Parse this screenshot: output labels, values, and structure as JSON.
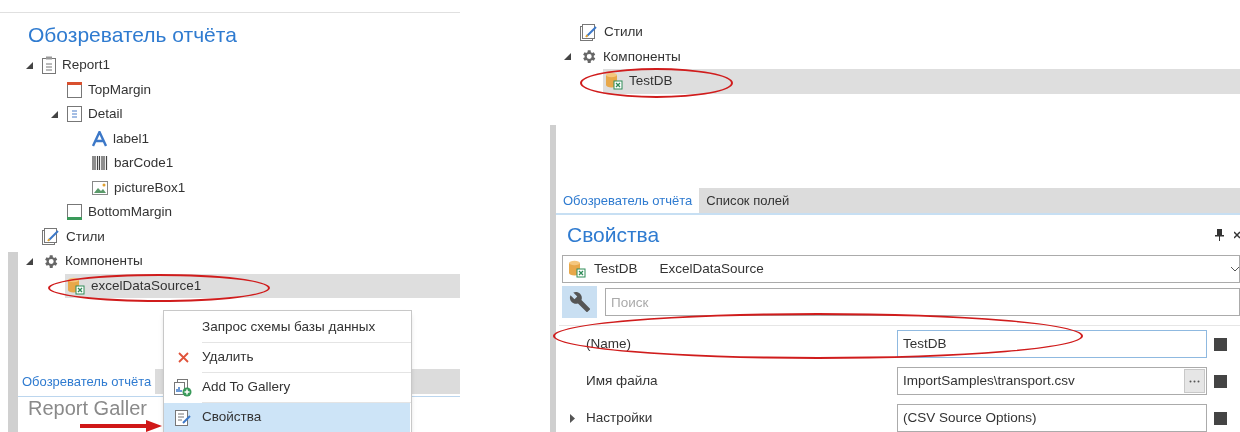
{
  "left_panel": {
    "title": "Обозреватель отчёта",
    "tree": [
      {
        "kind": "report",
        "label": "Report1",
        "selected": false,
        "expanded": true,
        "children": [
          {
            "kind": "band-top",
            "label": "TopMargin",
            "selected": false
          },
          {
            "kind": "band-detail",
            "label": "Detail",
            "selected": false,
            "expanded": true,
            "children": [
              {
                "kind": "label",
                "label": "label1",
                "selected": false
              },
              {
                "kind": "barcode",
                "label": "barCode1",
                "selected": false
              },
              {
                "kind": "picture",
                "label": "pictureBox1",
                "selected": false
              }
            ]
          },
          {
            "kind": "band-bottom",
            "label": "BottomMargin",
            "selected": false
          }
        ]
      },
      {
        "kind": "styles",
        "label": "Стили",
        "selected": false
      },
      {
        "kind": "components",
        "label": "Компоненты",
        "selected": false,
        "expanded": true,
        "children": [
          {
            "kind": "datasource",
            "label": "excelDataSource1",
            "selected": true
          }
        ]
      }
    ],
    "tabs": [
      {
        "label": "Обозреватель отчёта",
        "selected": true
      }
    ],
    "gallery_title": "Report Galler",
    "context_menu": [
      {
        "kind": "none",
        "label": "Запрос схемы базы данных",
        "selected": false
      },
      {
        "kind": "delete",
        "label": "Удалить",
        "selected": false
      },
      {
        "kind": "gallery",
        "label": "Add To Gallery",
        "selected": false
      },
      {
        "kind": "properties",
        "label": "Свойства",
        "selected": true
      }
    ]
  },
  "right_panel": {
    "tree": [
      {
        "kind": "styles",
        "label": "Стили",
        "selected": false
      },
      {
        "kind": "components",
        "label": "Компоненты",
        "selected": false,
        "expanded": true,
        "children": [
          {
            "kind": "datasource",
            "label": "TestDB",
            "selected": true
          }
        ]
      }
    ],
    "tabs": [
      {
        "label": "Обозреватель отчёта",
        "selected": true
      },
      {
        "label": "Список полей",
        "selected": false
      }
    ],
    "properties": {
      "title": "Свойства",
      "object_name": "TestDB",
      "object_type": "ExcelDataSource",
      "search_placeholder": "Поиск",
      "rows": [
        {
          "name": "(Name)",
          "value": "TestDB",
          "has_browse": false,
          "focused": true
        },
        {
          "name": "Имя файла",
          "value": "ImportSamples\\transport.csv",
          "has_browse": true,
          "focused": false
        },
        {
          "name": "Настройки",
          "value": "(CSV Source Options)",
          "has_browse": false,
          "focused": false,
          "expanded": false
        }
      ]
    }
  }
}
